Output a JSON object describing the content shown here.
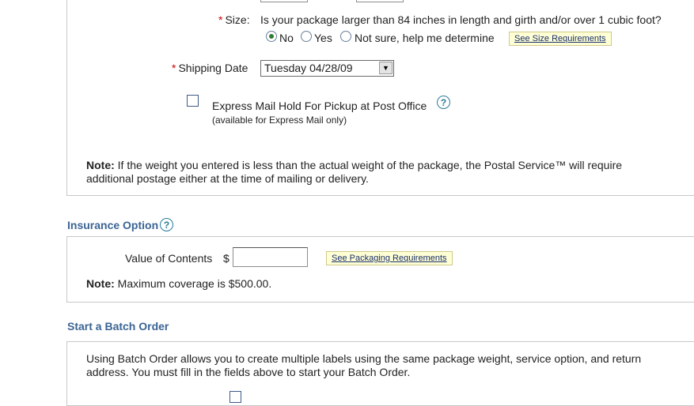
{
  "size": {
    "label": "Size:",
    "question": "Is your package larger than 84 inches in length and girth and/or over 1 cubic foot?",
    "options": [
      "No",
      "Yes",
      "Not sure, help me determine"
    ],
    "selected": "No",
    "requirements_link": "See Size Requirements"
  },
  "shipping_date": {
    "label": "Shipping Date",
    "value": "Tuesday 04/28/09"
  },
  "express_hold": {
    "label": "Express Mail Hold For Pickup at Post Office",
    "sublabel": "(available for Express Mail only)",
    "checked": false
  },
  "weight_note": {
    "bold": "Note:",
    "text": " If the weight you entered is less than the actual weight of the package, the Postal Service™ will require additional postage either at the time of mailing or delivery."
  },
  "insurance": {
    "title": "Insurance Option",
    "value_label": "Value of Contents",
    "currency": "$",
    "value": "",
    "packaging_link": "See Packaging Requirements",
    "note_bold": "Note:",
    "note_text": " Maximum coverage is $500.00."
  },
  "batch": {
    "title": "Start a Batch Order",
    "description": "Using Batch Order allows you to create multiple labels using the same package weight, service option, and return address.  You must fill in the fields above to start your Batch Order."
  },
  "help_glyph": "?",
  "select_arrow": "▼"
}
